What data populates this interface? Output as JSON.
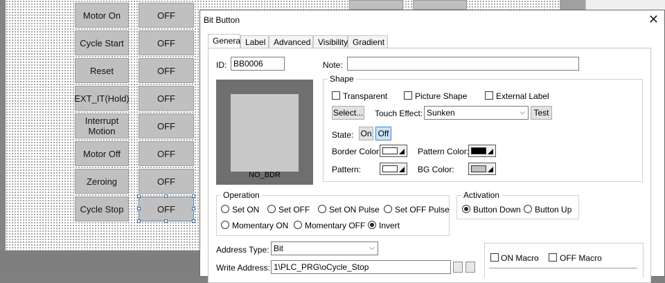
{
  "panel_buttons": {
    "labels": [
      "Motor On",
      "Cycle Start",
      "Reset",
      "EXT_IT(Hold)",
      "Interrupt\nMotion",
      "Motor Off",
      "Zeroing",
      "Cycle Stop"
    ],
    "values": [
      "OFF",
      "OFF",
      "OFF",
      "OFF",
      "OFF",
      "OFF",
      "OFF",
      "OFF"
    ]
  },
  "dialog": {
    "title": "Bit Button",
    "close_glyph": "✕",
    "tabs": [
      "General",
      "Label",
      "Advanced",
      "Visibility",
      "Gradient"
    ],
    "id_label": "ID:",
    "id_value": "BB0006",
    "note_label": "Note:",
    "note_value": "",
    "preview_caption": "NO_BDR",
    "shape": {
      "title": "Shape",
      "transparent_label": "Transparent",
      "picture_shape_label": "Picture Shape",
      "external_label_label": "External Label",
      "select_button": "Select...",
      "touch_effect_label": "Touch Effect:",
      "touch_effect_value": "Sunken",
      "test_button": "Test",
      "state_label": "State:",
      "state_on": "On",
      "state_off": "Off",
      "border_color_label": "Border Color:",
      "pattern_color_label": "Pattern Color:",
      "pattern_label": "Pattern:",
      "bg_color_label": "BG Color:",
      "border_color": "#ffffff",
      "pattern_color": "#000000",
      "pattern_swatch": "#ffffff",
      "bg_color": "#c0c0c0"
    },
    "operation": {
      "title": "Operation",
      "options": [
        "Set ON",
        "Set OFF",
        "Set ON Pulse",
        "Set OFF Pulse",
        "Momentary ON",
        "Momentary OFF",
        "Invert"
      ],
      "selected": "Invert"
    },
    "activation": {
      "title": "Activation",
      "options": [
        "Button Down",
        "Button Up"
      ],
      "selected": "Button Down"
    },
    "address_type_label": "Address Type:",
    "address_type_value": "Bit",
    "write_address_label": "Write Address:",
    "write_address_value": "1\\PLC_PRG\\oCycle_Stop",
    "macro": {
      "on_label": "ON Macro",
      "off_label": "OFF Macro"
    }
  }
}
